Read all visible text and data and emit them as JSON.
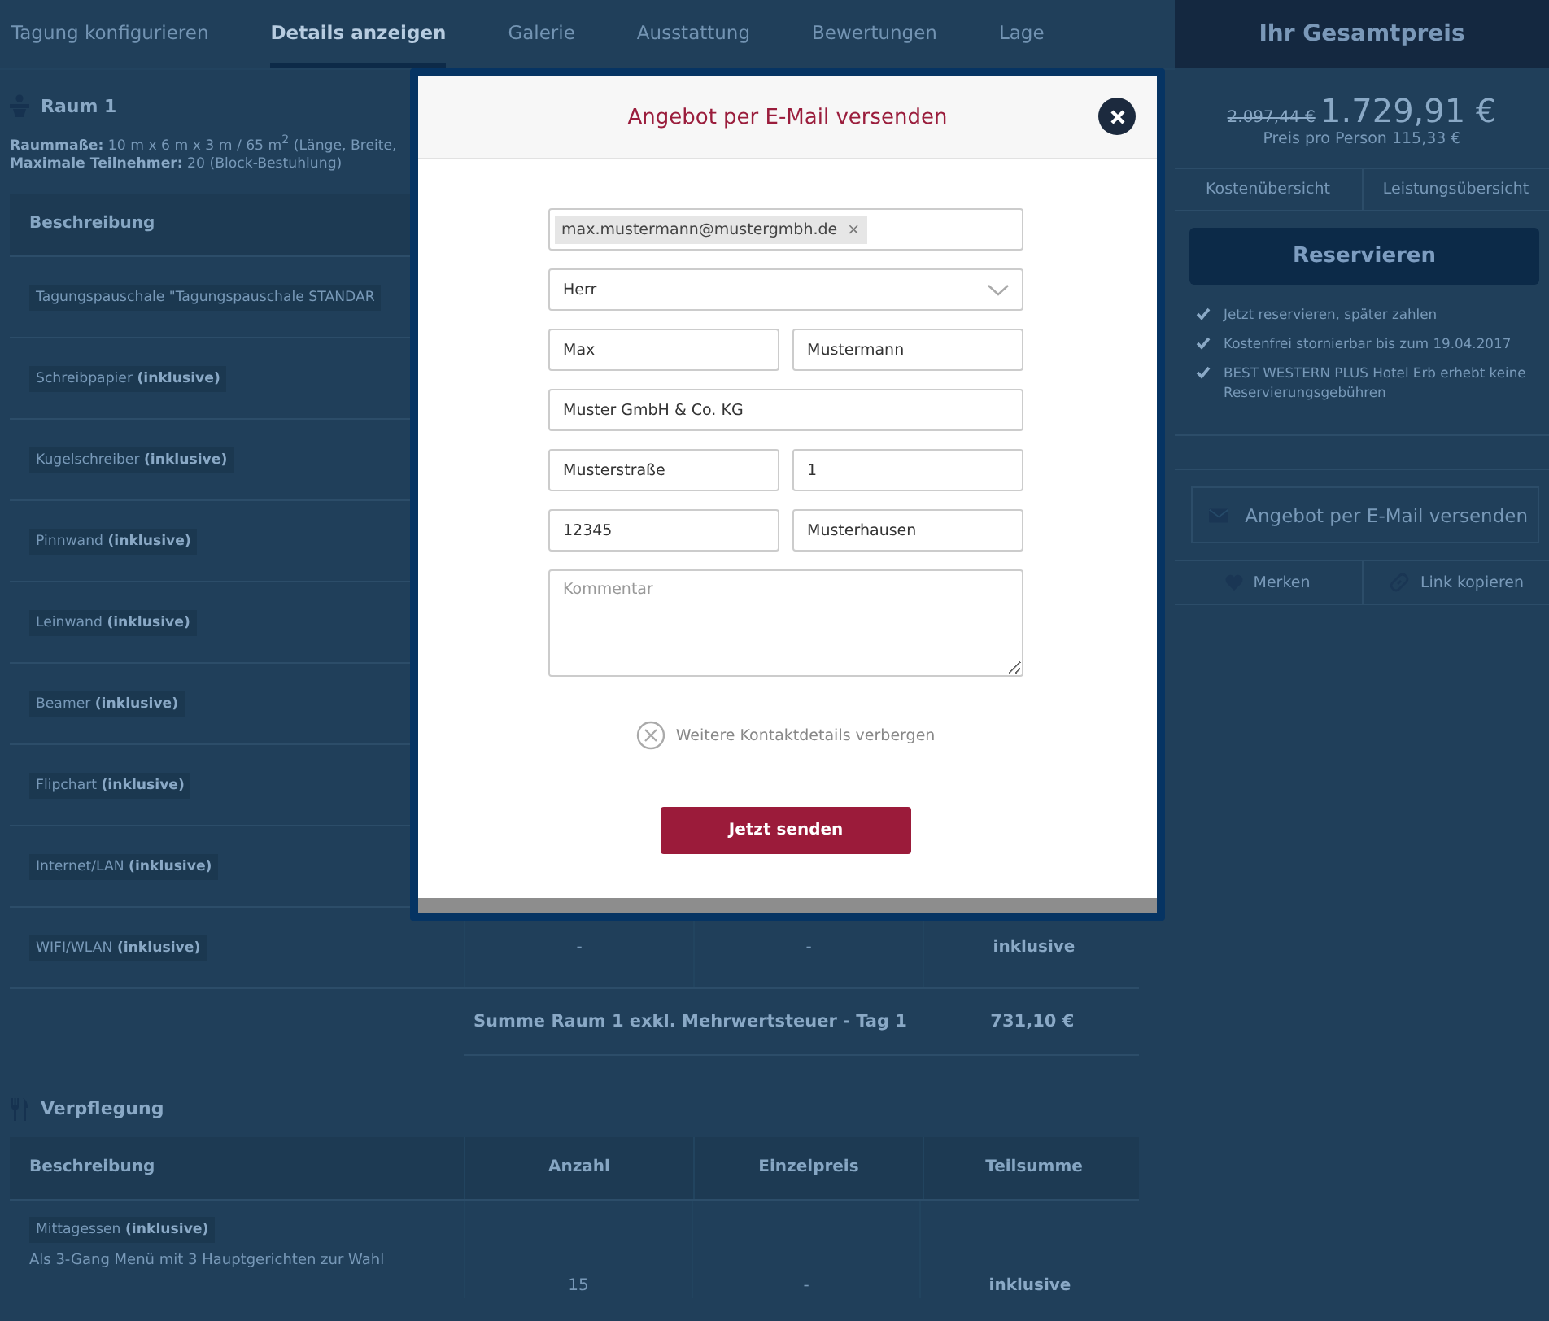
{
  "tabs": [
    {
      "label": "Tagung konfigurieren",
      "selected": false
    },
    {
      "label": "Details anzeigen",
      "selected": true
    },
    {
      "label": "Galerie",
      "selected": false
    },
    {
      "label": "Ausstattung",
      "selected": false
    },
    {
      "label": "Bewertungen",
      "selected": false
    },
    {
      "label": "Lage",
      "selected": false
    }
  ],
  "room": {
    "title": "Raum 1",
    "info": [
      "**Raummaße:** 10 m x 6 m x 3 m / 65 m$^{2}$ (Länge, Breite,",
      "**Maximale Teilnehmer:** 20 (Block-Bestuhlung)"
    ],
    "columns": [
      "Beschreibung"
    ],
    "rows": [
      {
        "description": "Tagungspauschale \"Tagungspauschale STANDAR"
      },
      {
        "description": "Schreibpapier **(inklusive)**"
      },
      {
        "description": "Kugelschreiber **(inklusive)**"
      },
      {
        "description": "Pinnwand **(inklusive)**"
      },
      {
        "description": "Leinwand **(inklusive)**"
      },
      {
        "description": "Beamer **(inklusive)**"
      },
      {
        "description": "Flipchart **(inklusive)**"
      },
      {
        "description": "Internet/LAN **(inklusive)**"
      },
      {
        "description": "WIFI/WLAN **(inklusive)**",
        "quantity": "-",
        "unit_price": "-",
        "subtotal": "inklusive"
      }
    ],
    "summary": {
      "label": "Summe Raum 1 exkl. Mehrwertsteuer - Tag 1",
      "amount": "731,10 €"
    }
  },
  "catering": {
    "title": "Verpflegung",
    "columns": [
      "Beschreibung",
      "Anzahl",
      "Einzelpreis",
      "Teilsumme"
    ],
    "rows": [
      {
        "description": "Mittagessen **(inklusive)**",
        "detail": "Als 3-Gang Menü mit 3 Hauptgerichten zur Wahl",
        "quantity": "15",
        "unit_price": "-",
        "subtotal": "inklusive"
      }
    ]
  },
  "sidebar": {
    "title": "Ihr Gesamtpreis",
    "old_price": "2.097,44 €",
    "price": "1.729,91 €",
    "per_person": "Preis pro Person 115,33 €",
    "tabs": [
      "Kostenübersicht",
      "Leistungsübersicht"
    ],
    "reserve_button": "Reservieren",
    "benefits": [
      "Jetzt reservieren, später zahlen",
      "Kostenfrei stornierbar bis zum 19.04.2017",
      "BEST WESTERN PLUS Hotel Erb erhebt keine Reservierungsgebühren"
    ],
    "email_button": "Angebot per E-Mail versenden",
    "actions": [
      {
        "kind": "heart",
        "label": "Merken"
      },
      {
        "kind": "link",
        "label": "Link kopieren"
      }
    ]
  },
  "modal": {
    "title": "Angebot per E-Mail versenden",
    "email_chip": "max.mustermann@mustergmbh.de",
    "chip_remove": "×",
    "salutation": "Herr",
    "first_name": "Max",
    "last_name": "Mustermann",
    "company": "Muster GmbH & Co. KG",
    "street": "Musterstraße",
    "house_number": "1",
    "zip": "12345",
    "city": "Musterhausen",
    "comment": {
      "placeholder": "Kommentar"
    },
    "toggle": "Weitere Kontaktdetails verbergen",
    "submit": "Jetzt senden"
  }
}
